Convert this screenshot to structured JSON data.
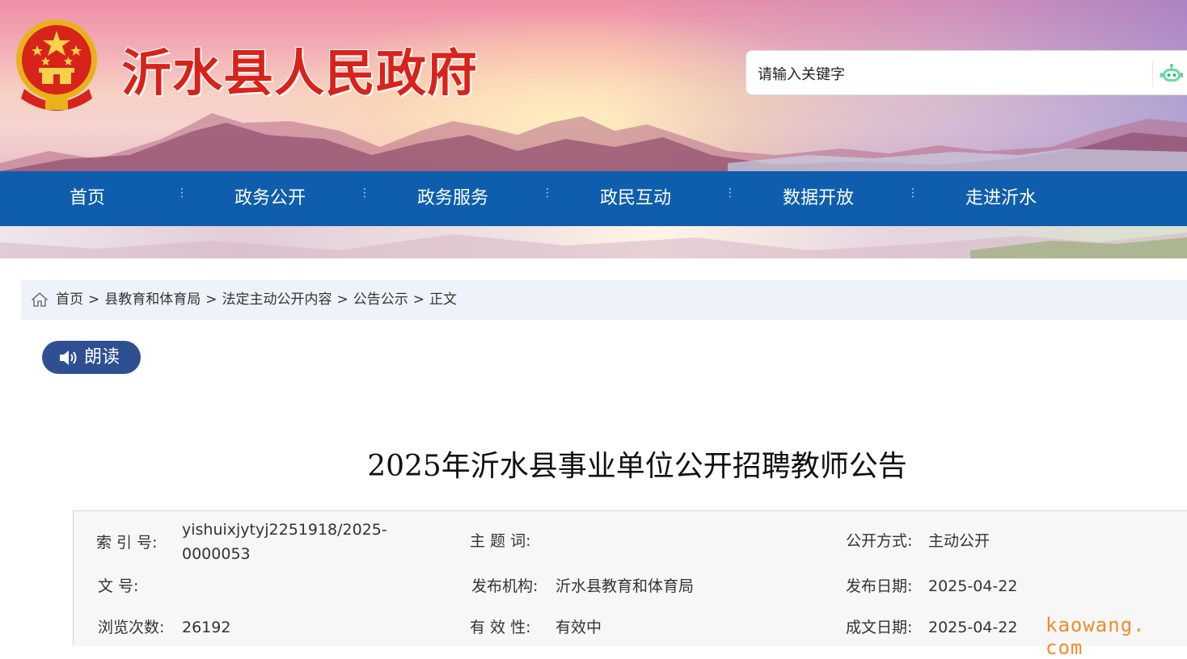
{
  "header": {
    "site_title": "沂水县人民政府",
    "search_placeholder": "请输入关键字",
    "emblem_icon": "national-emblem-icon",
    "search_icon": "robot-assistant-icon"
  },
  "nav": {
    "items": [
      "首页",
      "政务公开",
      "政务服务",
      "政民互动",
      "数据开放",
      "走进沂水"
    ]
  },
  "breadcrumb": {
    "icon": "home-icon",
    "items": [
      "首页",
      "县教育和体育局",
      "法定主动公开内容",
      "公告公示",
      "正文"
    ],
    "separator": ">"
  },
  "read_button": {
    "label": "朗读",
    "icon": "speaker-icon"
  },
  "article": {
    "title": "2025年沂水县事业单位公开招聘教师公告"
  },
  "meta": {
    "index_label": "索  引  号:",
    "index_value_line1": "yishuixjytyj2251918/2025-",
    "index_value_line2": "0000053",
    "topic_label": "主  题  词:",
    "topic_value": "",
    "method_label": "公开方式:",
    "method_value": "主动公开",
    "docno_label": "文      号:",
    "docno_value": "",
    "org_label": "发布机构:",
    "org_value": "沂水县教育和体育局",
    "pubdate_label": "发布日期:",
    "pubdate_value": "2025-04-22",
    "views_label": "浏览次数:",
    "views_value": "26192",
    "valid_label": "有  效  性:",
    "valid_value": "有效中",
    "written_label": "成文日期:",
    "written_value": "2025-04-22"
  },
  "watermark": "kaowang. com",
  "colors": {
    "nav_bg": "#0f5eae",
    "title_red": "#d8231a",
    "read_btn": "#2f4f93",
    "breadcrumb_bg": "#eef3fa",
    "watermark": "#f28b2a"
  }
}
